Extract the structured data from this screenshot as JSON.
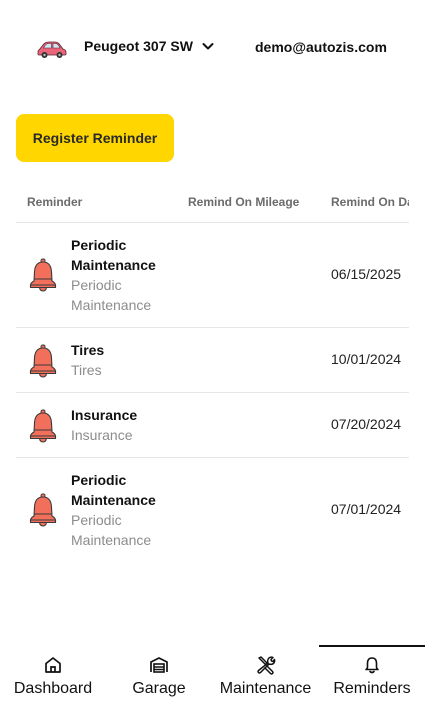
{
  "header": {
    "vehicle_name": "Peugeot 307 SW",
    "email": "demo@autozis.com"
  },
  "actions": {
    "register_label": "Register Reminder"
  },
  "table": {
    "columns": [
      "Reminder",
      "Remind On Mileage",
      "Remind On Da"
    ],
    "rows": [
      {
        "title": "Periodic Maintenance",
        "subtitle": "Periodic Maintenance",
        "mileage": "",
        "date": "06/15/2025"
      },
      {
        "title": "Tires",
        "subtitle": "Tires",
        "mileage": "",
        "date": "10/01/2024"
      },
      {
        "title": "Insurance",
        "subtitle": "Insurance",
        "mileage": "",
        "date": "07/20/2024"
      },
      {
        "title": "Periodic Maintenance",
        "subtitle": "Periodic Maintenance",
        "mileage": "",
        "date": "07/01/2024"
      }
    ]
  },
  "nav": {
    "items": [
      {
        "label": "Dashboard",
        "icon": "home-icon"
      },
      {
        "label": "Garage",
        "icon": "garage-icon"
      },
      {
        "label": "Maintenance",
        "icon": "tools-icon"
      },
      {
        "label": "Reminders",
        "icon": "bell-icon"
      }
    ],
    "active": "Reminders"
  },
  "colors": {
    "accent": "#FFD600",
    "bell": "#F2705B",
    "car": "#E8657A"
  }
}
